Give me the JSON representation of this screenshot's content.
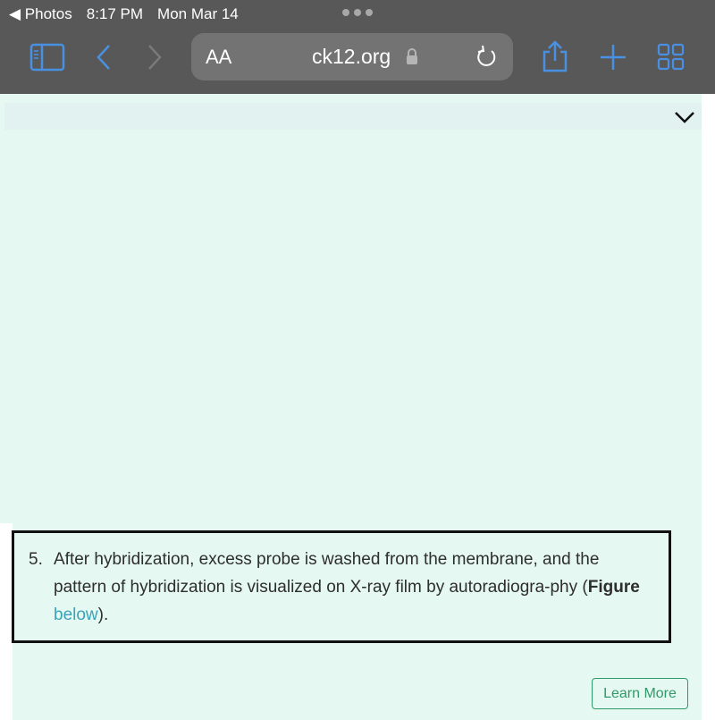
{
  "status_bar": {
    "back_app": "◀ Photos",
    "time": "8:17 PM",
    "date": "Mon Mar 14"
  },
  "toolbar": {
    "reader_label": "AA",
    "url": "ck12.org",
    "accent": "#4a90e2"
  },
  "content": {
    "item_number": "5.",
    "text_before": "After hybridization, excess probe is washed from the membrane, and the pattern of hybridization is visualized on X-ray film by autoradiogra-phy (",
    "bold": "Figure",
    "link": " below",
    "text_after": ").",
    "learn_more": "Learn More"
  }
}
